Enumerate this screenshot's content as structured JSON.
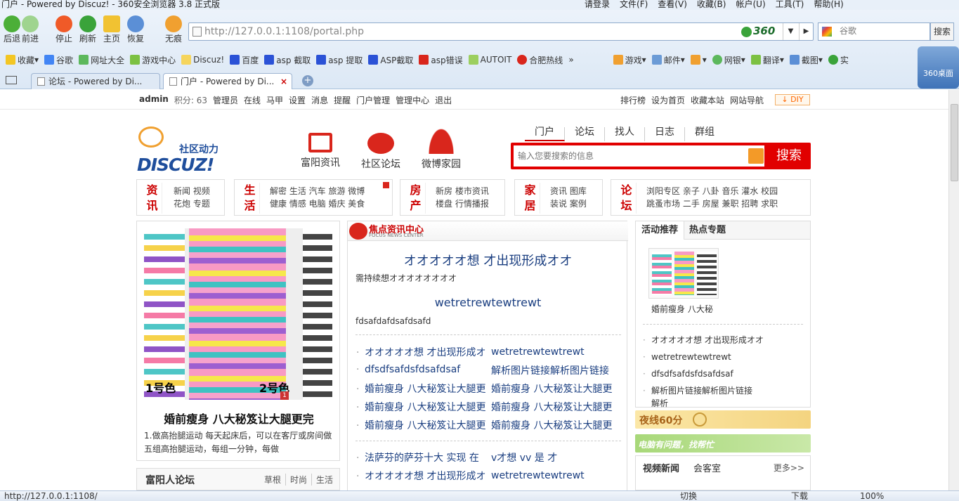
{
  "browser": {
    "window_title": "门户 - Powered by Discuz! - 360安全浏览器 3.8 正式版",
    "menu": [
      "请登录",
      "文件(F)",
      "查看(V)",
      "收藏(B)",
      "帐户(U)",
      "工具(T)",
      "帮助(H)"
    ],
    "nav_buttons": [
      "后退",
      "前进",
      "停止",
      "刷新",
      "主页",
      "恢复",
      "无痕"
    ],
    "url": "http://127.0.0.1:1108/portal.php",
    "url_badge": "360",
    "search_placeholder": "谷歌",
    "search_button": "搜索",
    "favorites": [
      "收藏",
      "谷歌",
      "网址大全",
      "游戏中心",
      "Discuz!",
      "百度",
      "asp 截取",
      "asp 提取",
      "ASP截取",
      "asp错误",
      "AUTOIT",
      "合肥热线",
      "»"
    ],
    "favorites_right": [
      "游戏",
      "邮件",
      "网银",
      "翻译",
      "截图",
      "实"
    ],
    "tabs": [
      "论坛 - Powered by Di...",
      "门户 - Powered by Di..."
    ],
    "desk360": "360桌面",
    "status_url": "http://127.0.0.1:1108/",
    "status_right": [
      "切换",
      "下载",
      "100%"
    ]
  },
  "topbar": {
    "user": "admin",
    "score": "积分: 63",
    "links": [
      "管理员",
      "在线",
      "马甲",
      "设置",
      "消息",
      "提醒",
      "门户管理",
      "管理中心",
      "退出"
    ],
    "right_links": [
      "排行榜",
      "设为首页",
      "收藏本站",
      "网站导航"
    ],
    "diy": "DIY"
  },
  "header": {
    "logo_text": "社区动力",
    "logo_brand": "DISCUZ!",
    "sections": [
      "富阳资讯",
      "社区论坛",
      "微博家园"
    ],
    "search_tabs": [
      "门户",
      "论坛",
      "找人",
      "日志",
      "群组"
    ],
    "search_placeholder": "输入您要搜索的信息",
    "search_button": "搜索"
  },
  "categories": [
    {
      "title": [
        "资",
        "讯"
      ],
      "row1": "新闻  视频",
      "row2": "花炮  专题"
    },
    {
      "title": [
        "生",
        "活"
      ],
      "row1": "解密  生活  汽车  旅游  微博",
      "row2": "健康  情感  电脑  婚庆  美食"
    },
    {
      "title": [
        "房",
        "产"
      ],
      "row1": "新房  楼市资讯",
      "row2": "楼盘  行情播报"
    },
    {
      "title": [
        "家",
        "居"
      ],
      "row1": "资讯  图库",
      "row2": "装说  案例"
    },
    {
      "title": [
        "论",
        "坛"
      ],
      "row1": "浏阳专区  亲子  八卦  音乐  灌水  校园",
      "row2": "跳蚤市场  二手  房屋  兼职  招聘  求职"
    }
  ],
  "feature": {
    "badge": "1",
    "label_left": "1号色",
    "label_right": "2号色",
    "title": "婚前瘦身 八大秘笈让大腿更完",
    "desc": "1.做高抬腿运动 每天起床后，可以在客厅或房间做五组高抬腿运动，每组一分钟，每做"
  },
  "left_forum": {
    "title": "富阳人论坛",
    "tags": [
      "草根",
      "时尚",
      "生活"
    ]
  },
  "focus": {
    "title": "焦点资讯中心",
    "subtitle": "FOCUS NEWS CENTER",
    "headline1": "オオオオオ想 才出现形成オオ",
    "desc1": "需持续想オオオオオオオオ",
    "headline2": "wetretrewtewtrewt",
    "desc2": "fdsafdafdsafdsafd",
    "list_left": [
      "オオオオオ想 才出现形成オ",
      "dfsdfsafdsfdsafdsaf",
      "婚前瘦身 八大秘笈让大腿更",
      "婚前瘦身 八大秘笈让大腿更",
      "婚前瘦身 八大秘笈让大腿更"
    ],
    "list_right": [
      "wetretrewtewtrewt",
      "解析图片链接解析图片链接",
      "婚前瘦身 八大秘笈让大腿更",
      "婚前瘦身 八大秘笈让大腿更",
      "婚前瘦身 八大秘笈让大腿更"
    ],
    "list2_left": [
      "法萨芬的萨芬十大 实现 在",
      "オオオオオ想 才出现形成オ"
    ],
    "list2_right": [
      "v才想 vv 是 才",
      "wetretrewtewtrewt"
    ]
  },
  "right": {
    "tab_active": "活动推荐",
    "tab_other": "热点专题",
    "caption": "婚前瘦身 八大秘",
    "list": [
      "オオオオオ想 才出现形成オオ",
      "wetretrewtewtrewt",
      "dfsdfsafdsfdsafdsaf",
      "解析图片链接解析图片链接",
      "解析"
    ],
    "banner1": "夜线60分",
    "banner2": "电脑有问题，找帮忙",
    "video_title": "视频新闻",
    "video_tab": "会客室",
    "more": "更多>>"
  },
  "colors": {
    "accent_red": "#e10000",
    "link_blue": "#1a3e80",
    "brand_blue": "#1f4e9c",
    "logo_orange": "#f0a030"
  }
}
